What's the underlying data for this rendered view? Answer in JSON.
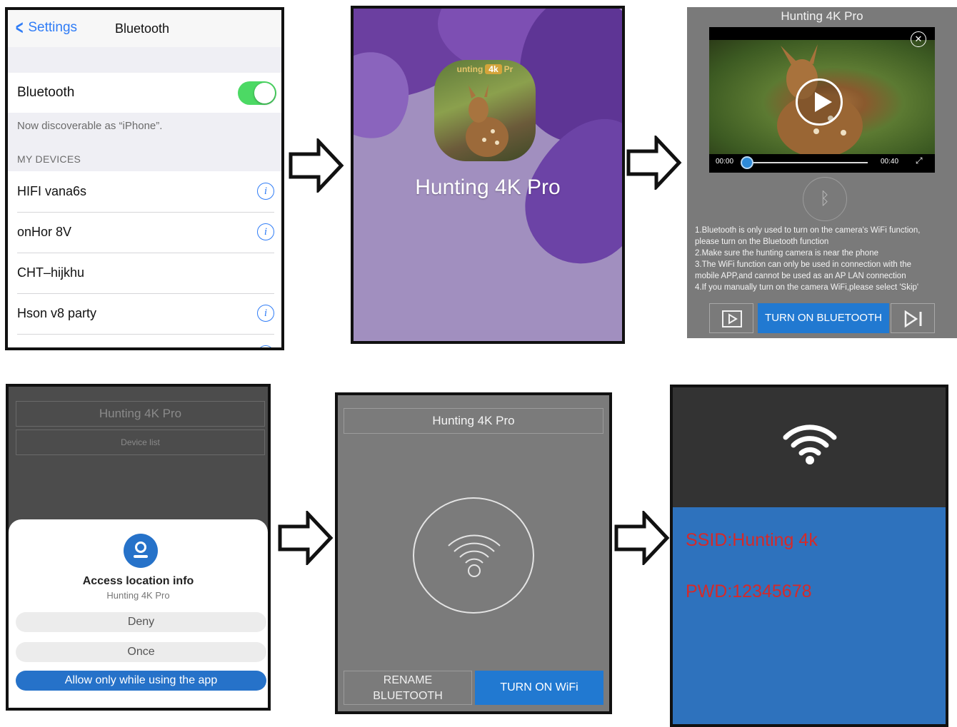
{
  "panel1": {
    "back_label": "Settings",
    "nav_title": "Bluetooth",
    "bluetooth_label": "Bluetooth",
    "bluetooth_on": true,
    "discoverable_text": "Now discoverable as “iPhone”.",
    "section_header": "MY DEVICES",
    "devices": [
      {
        "name": "HIFI vana6s",
        "info_icon": "info-icon"
      },
      {
        "name": "onHor 8V",
        "info_icon": "info-icon"
      },
      {
        "name": "CHT–hijkhu"
      },
      {
        "name": "Hson v8 party",
        "info_icon": "info-icon"
      }
    ],
    "accent_color": "#2f7cf6",
    "toggle_color": "#4cd964"
  },
  "panel2": {
    "icon_label_left": "unting",
    "icon_badge": "4k",
    "icon_label_right": "Pr",
    "title": "Hunting 4K Pro"
  },
  "panel3": {
    "title": "Hunting 4K Pro",
    "time_start": "00:00",
    "time_end": "00:40",
    "progress": 0.0,
    "instructions": [
      "1.Bluetooth is only used to turn on the camera's WiFi function,",
      "please turn on the Bluetooth function",
      "2.Make sure the hunting camera is near the phone",
      "3.The WiFi function can only be used in connection with the",
      "mobile APP,and cannot be used as an AP LAN connection",
      "4.If you manually turn on the camera WiFi,please select 'Skip'"
    ],
    "main_button": "TURN ON BLUETOOTH",
    "accent_color": "#2179d1"
  },
  "panel4": {
    "header_title": "Hunting 4K Pro",
    "header_sub": "Device list",
    "dialog_title": "Access location info",
    "dialog_sub": "Hunting 4K Pro",
    "options": [
      "Deny",
      "Once",
      "Allow only while using the app"
    ],
    "accent_color": "#2672c9"
  },
  "panel5": {
    "title": "Hunting 4K Pro",
    "rename_line1": "RENAME",
    "rename_line2": "BLUETOOTH",
    "wifi_button": "TURN ON WiFi"
  },
  "panel6": {
    "ssid": "SSID:Hunting 4k",
    "pwd": "PWD:12345678",
    "text_color": "#d42a2a",
    "background_color": "#2e72bd"
  }
}
